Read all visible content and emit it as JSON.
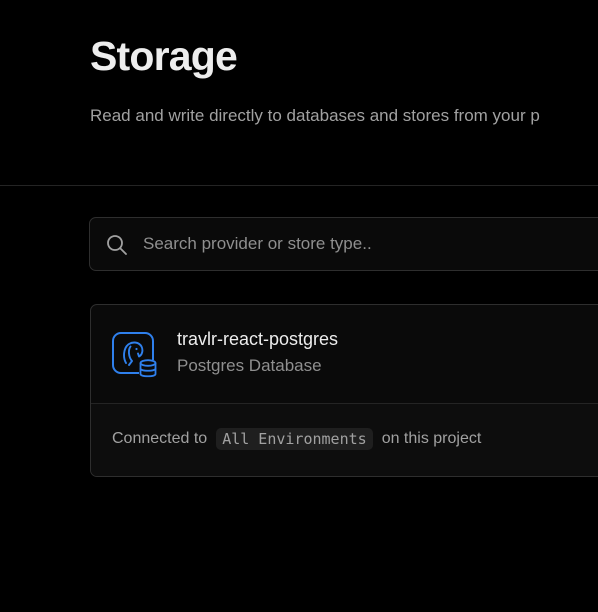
{
  "header": {
    "title": "Storage",
    "subtitle": "Read and write directly to databases and stores from your p"
  },
  "search": {
    "placeholder": "Search provider or store type..",
    "value": "",
    "icon": "search-icon"
  },
  "stores": [
    {
      "name": "travlr-react-postgres",
      "type": "Postgres Database",
      "icon": "postgres-database-icon",
      "connection_prefix": "Connected to",
      "environment": "All Environments",
      "connection_suffix": "on this project"
    }
  ],
  "colors": {
    "background": "#000000",
    "card_background": "#0a0a0a",
    "border": "#2e2e2e",
    "text_primary": "#ededed",
    "text_secondary": "#a1a1a1",
    "accent_blue": "#2f80ed"
  }
}
